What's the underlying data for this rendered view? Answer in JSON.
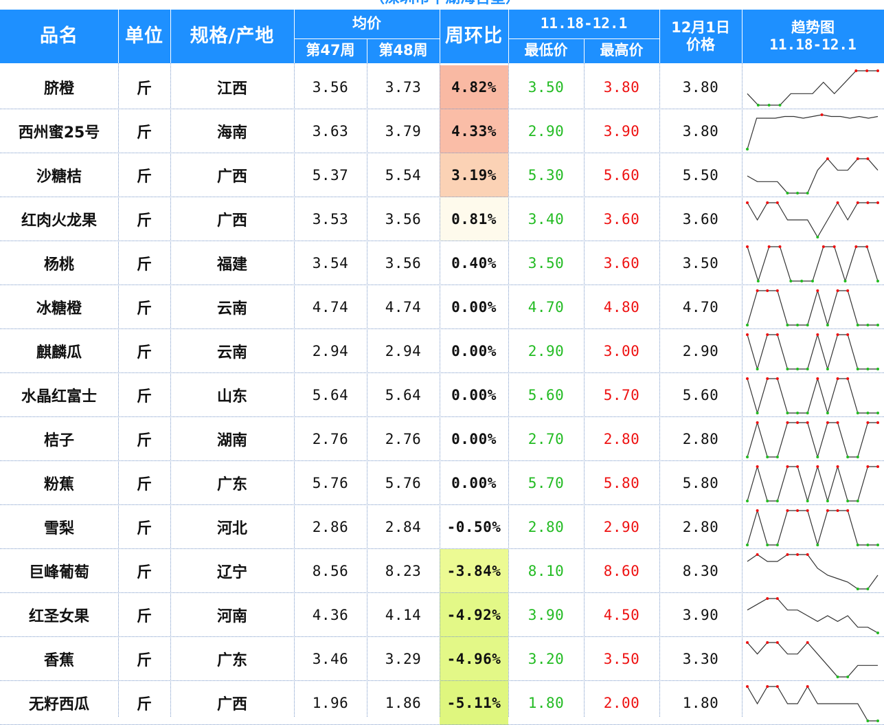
{
  "caption": "（深圳市平湖海吉星）",
  "headers": {
    "name": "品名",
    "unit": "单位",
    "spec": "规格/产地",
    "avg_group": "均价",
    "week47": "第47周",
    "week48": "第48周",
    "wow": "周环比",
    "range_group": "11.18-12.1",
    "min": "最低价",
    "max": "最高价",
    "price_line1": "12月1日",
    "price_line2": "价格",
    "trend_line1": "趋势图",
    "trend_line2": "11.18-12.1"
  },
  "colors": {
    "header_bg": "#1e90ff",
    "low_text": "#22bb22",
    "high_text": "#ee1111",
    "spark_line": "#333333",
    "spark_high_marker": "#ee1111",
    "spark_low_marker": "#22bb22"
  },
  "rows": [
    {
      "name": "脐橙",
      "unit": "斤",
      "origin": "江西",
      "w47": "3.56",
      "w48": "3.73",
      "wow": "4.82%",
      "wow_bg": "#f9b9a3",
      "min": "3.50",
      "max": "3.80",
      "price": "3.80",
      "trend": [
        3.6,
        3.5,
        3.5,
        3.5,
        3.6,
        3.6,
        3.6,
        3.7,
        3.6,
        3.7,
        3.8,
        3.8,
        3.8
      ]
    },
    {
      "name": "西州蜜25号",
      "unit": "斤",
      "origin": "海南",
      "w47": "3.63",
      "w48": "3.79",
      "wow": "4.33%",
      "wow_bg": "#fabda7",
      "min": "2.90",
      "max": "3.90",
      "price": "3.80",
      "trend": [
        2.9,
        3.8,
        3.8,
        3.8,
        3.85,
        3.85,
        3.8,
        3.85,
        3.9,
        3.85,
        3.85,
        3.8,
        3.85,
        3.8,
        3.85
      ]
    },
    {
      "name": "沙糖桔",
      "unit": "斤",
      "origin": "广西",
      "w47": "5.37",
      "w48": "5.54",
      "wow": "3.19%",
      "wow_bg": "#fbd2b5",
      "min": "5.30",
      "max": "5.60",
      "price": "5.50",
      "trend": [
        5.45,
        5.4,
        5.4,
        5.4,
        5.3,
        5.3,
        5.3,
        5.5,
        5.6,
        5.5,
        5.5,
        5.6,
        5.6,
        5.5
      ]
    },
    {
      "name": "红肉火龙果",
      "unit": "斤",
      "origin": "广西",
      "w47": "3.53",
      "w48": "3.56",
      "wow": "0.81%",
      "wow_bg": "#fefaec",
      "min": "3.40",
      "max": "3.60",
      "price": "3.60",
      "trend": [
        3.6,
        3.5,
        3.6,
        3.6,
        3.5,
        3.5,
        3.5,
        3.4,
        3.5,
        3.6,
        3.5,
        3.6,
        3.6,
        3.6
      ]
    },
    {
      "name": "杨桃",
      "unit": "斤",
      "origin": "福建",
      "w47": "3.54",
      "w48": "3.56",
      "wow": "0.40%",
      "wow_bg": "",
      "min": "3.50",
      "max": "3.60",
      "price": "3.50",
      "trend": [
        3.6,
        3.5,
        3.6,
        3.6,
        3.5,
        3.5,
        3.5,
        3.6,
        3.6,
        3.5,
        3.6,
        3.6,
        3.5
      ]
    },
    {
      "name": "冰糖橙",
      "unit": "斤",
      "origin": "云南",
      "w47": "4.74",
      "w48": "4.74",
      "wow": "0.00%",
      "wow_bg": "",
      "min": "4.70",
      "max": "4.80",
      "price": "4.70",
      "trend": [
        4.7,
        4.8,
        4.8,
        4.8,
        4.7,
        4.7,
        4.7,
        4.8,
        4.7,
        4.8,
        4.8,
        4.7,
        4.7,
        4.7
      ]
    },
    {
      "name": "麒麟瓜",
      "unit": "斤",
      "origin": "云南",
      "w47": "2.94",
      "w48": "2.94",
      "wow": "0.00%",
      "wow_bg": "",
      "min": "2.90",
      "max": "3.00",
      "price": "2.90",
      "trend": [
        3.0,
        2.9,
        3.0,
        3.0,
        2.9,
        2.9,
        2.9,
        3.0,
        2.9,
        3.0,
        3.0,
        2.9,
        2.9,
        2.9
      ]
    },
    {
      "name": "水晶红富士",
      "unit": "斤",
      "origin": "山东",
      "w47": "5.64",
      "w48": "5.64",
      "wow": "0.00%",
      "wow_bg": "",
      "min": "5.60",
      "max": "5.70",
      "price": "5.60",
      "trend": [
        5.7,
        5.6,
        5.7,
        5.7,
        5.6,
        5.6,
        5.6,
        5.7,
        5.6,
        5.7,
        5.7,
        5.6,
        5.6,
        5.6
      ]
    },
    {
      "name": "桔子",
      "unit": "斤",
      "origin": "湖南",
      "w47": "2.76",
      "w48": "2.76",
      "wow": "0.00%",
      "wow_bg": "",
      "min": "2.70",
      "max": "2.80",
      "price": "2.80",
      "trend": [
        2.7,
        2.8,
        2.7,
        2.7,
        2.8,
        2.8,
        2.8,
        2.7,
        2.8,
        2.8,
        2.7,
        2.7,
        2.8,
        2.8
      ]
    },
    {
      "name": "粉蕉",
      "unit": "斤",
      "origin": "广东",
      "w47": "5.76",
      "w48": "5.76",
      "wow": "0.00%",
      "wow_bg": "",
      "min": "5.70",
      "max": "5.80",
      "price": "5.80",
      "trend": [
        5.7,
        5.8,
        5.7,
        5.7,
        5.8,
        5.8,
        5.7,
        5.8,
        5.7,
        5.8,
        5.7,
        5.7,
        5.8,
        5.8
      ]
    },
    {
      "name": "雪梨",
      "unit": "斤",
      "origin": "河北",
      "w47": "2.86",
      "w48": "2.84",
      "wow": "-0.50%",
      "wow_bg": "",
      "min": "2.80",
      "max": "2.90",
      "price": "2.80",
      "trend": [
        2.8,
        2.9,
        2.8,
        2.8,
        2.9,
        2.9,
        2.9,
        2.8,
        2.9,
        2.9,
        2.9,
        2.8,
        2.8,
        2.8
      ]
    },
    {
      "name": "巨峰葡萄",
      "unit": "斤",
      "origin": "辽宁",
      "w47": "8.56",
      "w48": "8.23",
      "wow": "-3.84%",
      "wow_bg": "#ecfa93",
      "min": "8.10",
      "max": "8.60",
      "price": "8.30",
      "trend": [
        8.5,
        8.6,
        8.5,
        8.5,
        8.6,
        8.6,
        8.6,
        8.4,
        8.3,
        8.25,
        8.2,
        8.1,
        8.1,
        8.3
      ]
    },
    {
      "name": "红圣女果",
      "unit": "斤",
      "origin": "河南",
      "w47": "4.36",
      "w48": "4.14",
      "wow": "-4.92%",
      "wow_bg": "#e3f887",
      "min": "3.90",
      "max": "4.50",
      "price": "3.90",
      "trend": [
        4.3,
        4.4,
        4.5,
        4.5,
        4.3,
        4.3,
        4.2,
        4.1,
        4.2,
        4.1,
        4.2,
        4.0,
        4.0,
        3.9
      ]
    },
    {
      "name": "香蕉",
      "unit": "斤",
      "origin": "广东",
      "w47": "3.46",
      "w48": "3.29",
      "wow": "-4.96%",
      "wow_bg": "#e3f887",
      "min": "3.20",
      "max": "3.50",
      "price": "3.30",
      "trend": [
        3.5,
        3.4,
        3.5,
        3.5,
        3.4,
        3.4,
        3.5,
        3.4,
        3.3,
        3.2,
        3.2,
        3.3,
        3.3,
        3.3
      ]
    },
    {
      "name": "无籽西瓜",
      "unit": "斤",
      "origin": "广西",
      "w47": "1.96",
      "w48": "1.86",
      "wow": "-5.11%",
      "wow_bg": "#dff67e",
      "min": "1.80",
      "max": "2.00",
      "price": "1.80",
      "trend": [
        2.0,
        1.9,
        2.0,
        2.0,
        1.9,
        1.9,
        2.0,
        1.9,
        1.9,
        1.9,
        1.9,
        1.9,
        1.8,
        1.8
      ]
    }
  ]
}
